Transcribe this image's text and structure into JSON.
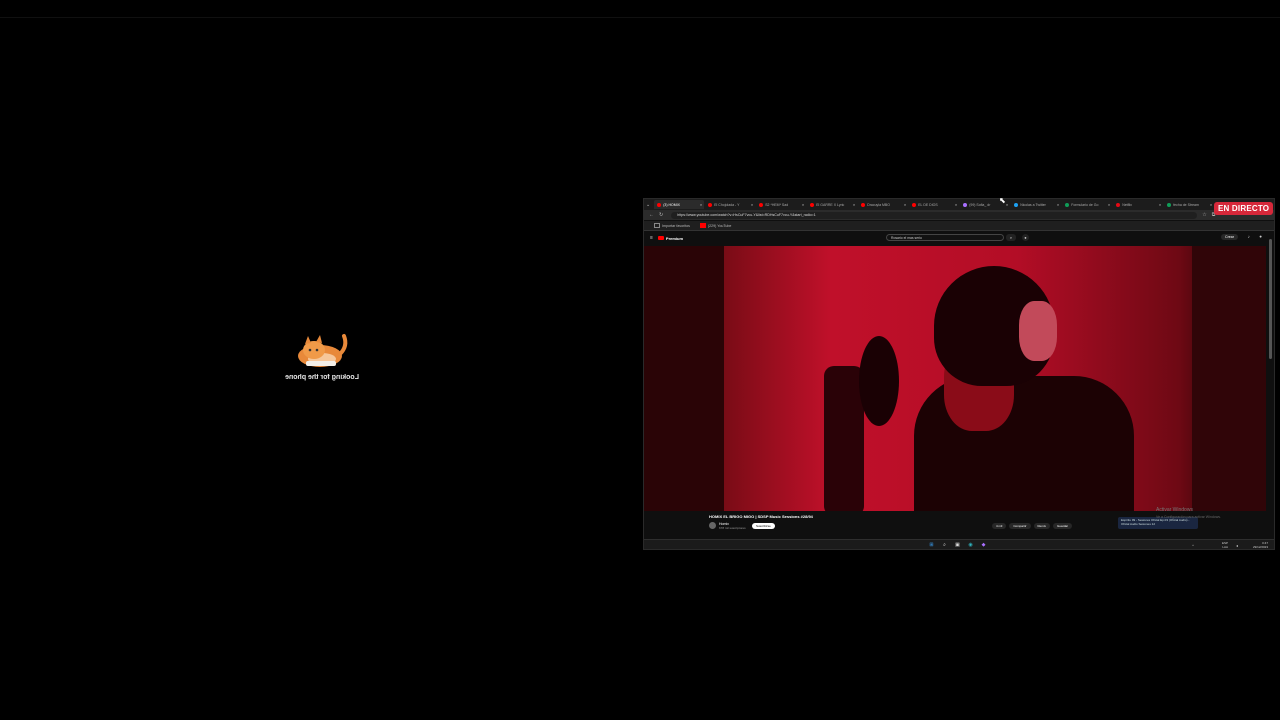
{
  "overlay": {
    "caption": "Looking for the phone"
  },
  "badge": {
    "live_label": "EN DIRECTO",
    "color": "#d6283a"
  },
  "browser": {
    "tabs": [
      {
        "label": "(3) HOMIX",
        "color": "#ff0000"
      },
      {
        "label": "El Chojolada - Y",
        "color": "#ff0000"
      },
      {
        "label": "S2 *HEM* Sad",
        "color": "#ff0000"
      },
      {
        "label": "El GARRE X Lyric",
        "color": "#ff0000"
      },
      {
        "label": "Dracuyla MBO",
        "color": "#ff0000"
      },
      {
        "label": "EL DE DIOS",
        "color": "#ff0000"
      },
      {
        "label": "(99) Sofia_ dr",
        "color": "#a970ff"
      },
      {
        "label": "Nicolas a Twitter",
        "color": "#1da1f2"
      },
      {
        "label": "Formulario de Go",
        "color": "#0f9d58"
      },
      {
        "label": "Netflix",
        "color": "#e50914"
      },
      {
        "label": "fecha de Stream",
        "color": "#0f9d58"
      }
    ],
    "url": "https://www.youtube.com/watch?v=HsCuF7vcu-Y&list=RDHsCuF7vcu-Y&start_radio=1",
    "bookmarks": [
      "Importar favoritos",
      "(229) YouTube"
    ]
  },
  "youtube": {
    "logo": "Premium",
    "search_text": "Rosario el mas serio",
    "create_label": "Crear",
    "video_title": "HOMIX EL BRIGO MIGO | SDSP Music Sessions #28/94",
    "channel": "Homix",
    "subs": "678 mil suscriptores",
    "subscribe_label": "Suscribirse",
    "actions": [
      "4 mil",
      "Compartir",
      "Remix",
      "Guardar"
    ],
    "up_next": "Espiritu 99 - Sesiones Oficial Ep.03 (Oficial Audio) - Oficial Audio Sesiones 12"
  },
  "watermark": {
    "line1": "Activar Windows",
    "line2": "Ve a Configuración para activar Windows."
  },
  "taskbar": {
    "lang": "ESP",
    "region": "LAA",
    "time": "0:47",
    "date": "29/12/2023"
  }
}
